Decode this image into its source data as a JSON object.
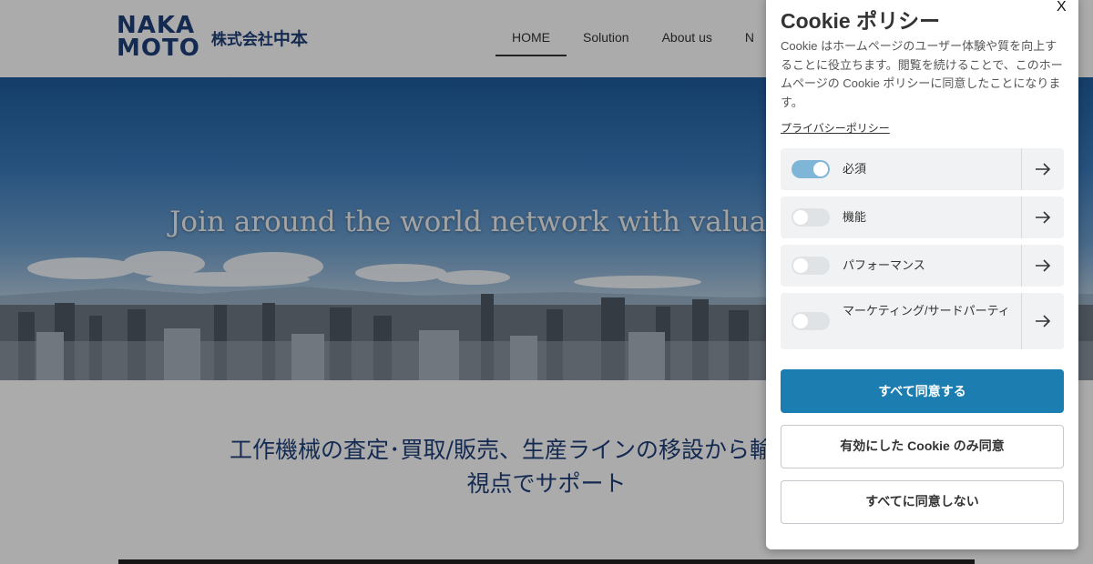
{
  "header": {
    "logo_line1": "NAKA",
    "logo_line2": "MOTO",
    "company_prefix": "株式会社",
    "company_name": "中本",
    "nav": [
      {
        "label": "HOME",
        "active": true
      },
      {
        "label": "Solution"
      },
      {
        "label": "About us"
      },
      {
        "label": "N"
      }
    ]
  },
  "hero": {
    "tagline": "Join around the world network with valuable i"
  },
  "intro": {
    "line1": "工作機械の査定･買取/販売、生産ラインの移設から輸出まで製",
    "line2": "視点でサポート"
  },
  "cookie": {
    "title": "Cookie ポリシー",
    "close_label": "X",
    "description": "Cookie はホームページのユーザー体験や質を向上することに役立ちます。閲覧を続けることで、このホームページの Cookie ポリシーに同意したことになります。",
    "privacy_link": "プライバシーポリシー",
    "categories": [
      {
        "label": "必須",
        "enabled": true
      },
      {
        "label": "機能",
        "enabled": false
      },
      {
        "label": "パフォーマンス",
        "enabled": false
      },
      {
        "label": "マーケティング/サードパーティ",
        "enabled": false
      }
    ],
    "accept_all": "すべて同意する",
    "accept_selected": "有効にした Cookie のみ同意",
    "reject_all": "すべてに同意しない"
  },
  "colors": {
    "brand": "#1f3f7a",
    "primary_button": "#1b7db0",
    "toggle_on": "#7fb6d8"
  },
  "icons": {
    "category_arrow": "arrow-right-icon"
  }
}
